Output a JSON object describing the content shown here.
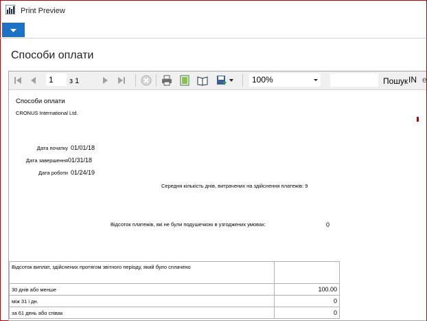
{
  "window": {
    "title": "Print Preview"
  },
  "page_title": "Способи оплати",
  "toolbar": {
    "page_number": "1",
    "page_of": "з 1",
    "zoom": "100%",
    "search_label": "Пошук",
    "search_term": "IN",
    "search_next": "e",
    "icons": [
      "first-page-icon",
      "prev-page-icon",
      "next-page-icon",
      "last-page-icon",
      "stop-icon",
      "print-icon",
      "print-layout-icon",
      "page-setup-icon",
      "export-icon"
    ]
  },
  "report": {
    "title": "Способи оплати",
    "company": "CRONUS International Ltd.",
    "start_date_label": "Дата початку",
    "start_date": "01/01/18",
    "end_date_label": "Дата завершення",
    "end_date": "01/31/18",
    "work_date_label": "Дата роботи",
    "work_date": "01/24/19",
    "avg_days_text": "Середня кількість днів, витрачених на здійснення платежів: 9",
    "pct_not_double_label": "Відсоток платежів, які не були подушечкою в узгоджених умовах:",
    "pct_not_double_value": "0",
    "table": {
      "header": "Відсоток виплат, здійснених протягом звітного періоду, який було сплачено",
      "rows": [
        {
          "label": "30 днів або менше",
          "value": "100.00"
        },
        {
          "label": "між 31 і дн.",
          "value": "0"
        },
        {
          "label": "за 61 день або співак",
          "value": "0"
        }
      ]
    }
  },
  "colors": {
    "accent": "#1e72c6",
    "frame": "#c00000"
  }
}
